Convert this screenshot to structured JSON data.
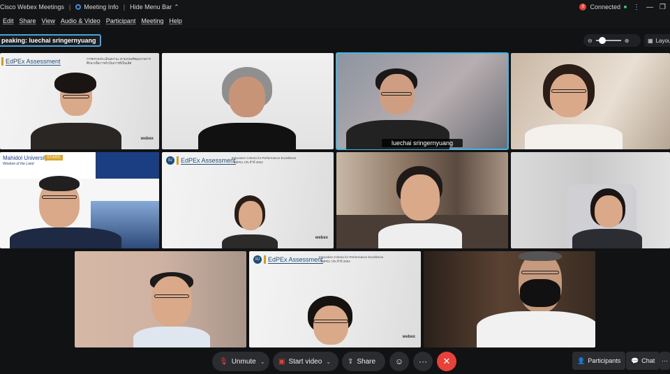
{
  "titlebar": {
    "app_name": "Cisco Webex Meetings",
    "meeting_info": "Meeting Info",
    "hide_menu": "Hide Menu Bar",
    "status_badge": "0",
    "connection": "Connected"
  },
  "menu": [
    "Edit",
    "Share",
    "View",
    "Audio & Video",
    "Participant",
    "Meeting",
    "Help"
  ],
  "speaking": {
    "text": "peaking: luechai sringernyuang"
  },
  "layout_label": "Layou",
  "tiles": {
    "active_name": "luechai sringernyuang",
    "slide_brand": "EdPEx Assessment",
    "slide_thai": "การตรวจประเมินสถานะ ตามเกณฑ์คุณภาพการศึกษาเพื่อการดำเนินการที่เป็นเลิศ",
    "slide_sub": "Education Criteria for Performance Excellence - EdPEx ประจำปี 2564",
    "webex_mark": "webex",
    "uni_name": "Mahidol University",
    "uni_tagline": "Wisdom of the Land",
    "stars": "STARS"
  },
  "controls": {
    "unmute": "Unmute",
    "start_video": "Start video",
    "share": "Share",
    "more": "···",
    "participants": "Participants",
    "chat": "Chat",
    "overflow": "···"
  },
  "colors": {
    "accent": "#44b6e6",
    "end_call": "#e8413a",
    "background": "#111214"
  }
}
